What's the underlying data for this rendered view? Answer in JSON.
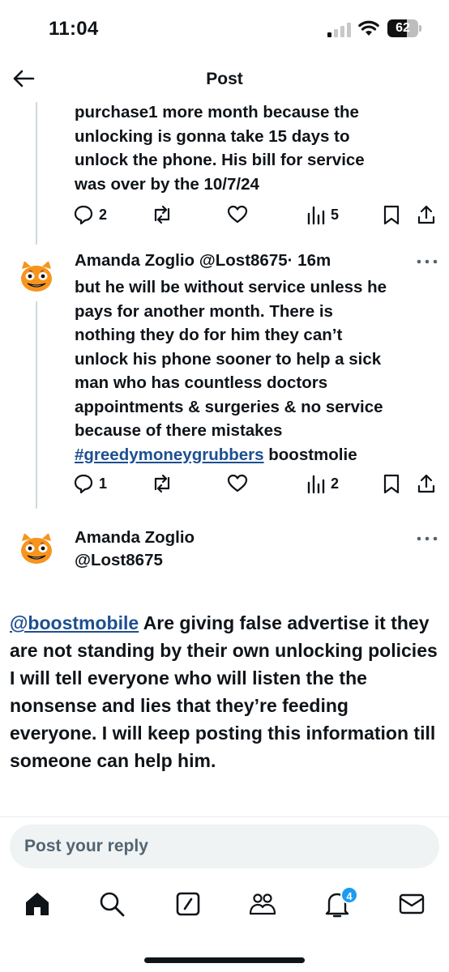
{
  "status_bar": {
    "time": "11:04",
    "battery_percent": "62",
    "battery_level": 0.62
  },
  "header": {
    "title": "Post",
    "back_icon": "back-arrow-icon"
  },
  "thread": [
    {
      "text_lines": [
        "purchase1 more month because the",
        "unlocking is gonna take 15 days to",
        "unlock the phone. His bill for service",
        "was over by the 10/7/24"
      ],
      "replies": "2",
      "views": "5"
    },
    {
      "author": "Amanda Zoglio",
      "handle": "@Lost8675",
      "time": "· 16m",
      "text_lines": [
        "but he will be without service unless he",
        "pays for another month. There is",
        "nothing they do for him they can’t",
        "unlock his phone sooner to help a sick",
        "man who has countless doctors",
        "appointments & surgeries & no service",
        "because of there mistakes"
      ],
      "hashtag": "#greedymoneygrubbers",
      "after_hashtag": " boostmolie",
      "replies": "1",
      "views": "2"
    }
  ],
  "main_post": {
    "author": "Amanda Zoglio",
    "handle": "@Lost8675",
    "mention": "@boostmobile",
    "text": " Are giving false advertise it they are not standing by their own unlocking policies I will tell everyone who will listen the the nonsense and lies that they’re feeding everyone. I will keep posting this information till someone can help him."
  },
  "reply": {
    "placeholder": "Post your reply"
  },
  "tabbar": {
    "notifications_badge": "4",
    "icons": [
      "home-icon",
      "search-icon",
      "grok-icon",
      "communities-icon",
      "notifications-icon",
      "messages-icon"
    ]
  },
  "colors": {
    "text": "#0f1419",
    "link": "#1d4f91",
    "accent": "#1d9bf0",
    "reply_bg": "#eff3f4"
  }
}
